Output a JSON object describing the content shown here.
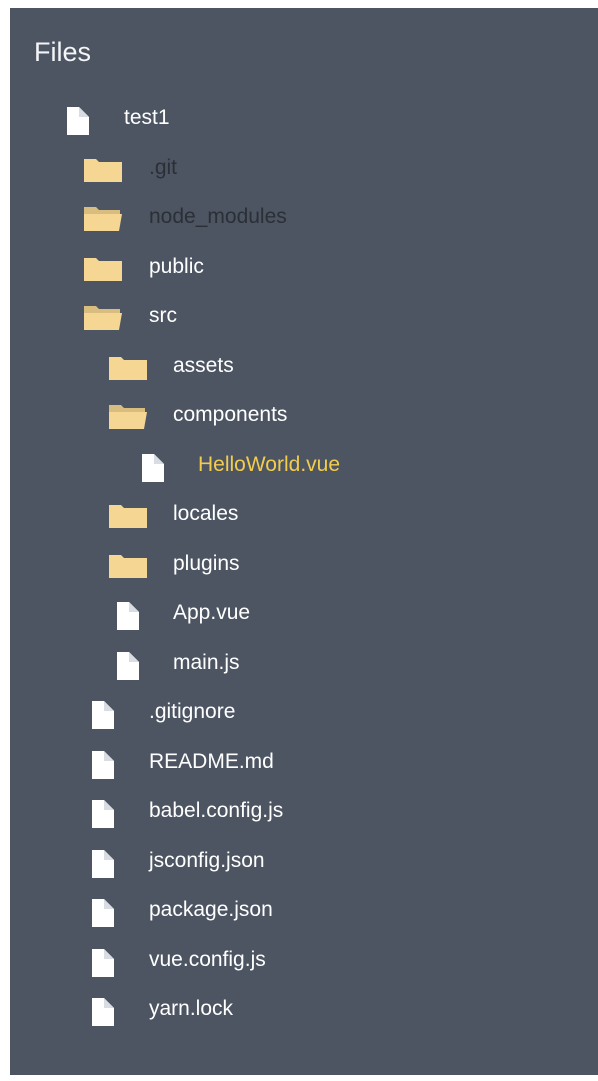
{
  "title": "Files",
  "colors": {
    "panel_bg": "#4d5563",
    "text": "#ffffff",
    "dimmed_text": "#2b2f36",
    "selected_text": "#f2cc4d",
    "folder": "#f6d693",
    "file": "#ffffff"
  },
  "tree": [
    {
      "name": "test1",
      "type": "file",
      "depth": 0
    },
    {
      "name": ".git",
      "type": "folder",
      "depth": 1,
      "dimmed": true
    },
    {
      "name": "node_modules",
      "type": "folder-open",
      "depth": 1,
      "dimmed": true
    },
    {
      "name": "public",
      "type": "folder",
      "depth": 1
    },
    {
      "name": "src",
      "type": "folder-open",
      "depth": 1
    },
    {
      "name": "assets",
      "type": "folder",
      "depth": 2
    },
    {
      "name": "components",
      "type": "folder-open",
      "depth": 2
    },
    {
      "name": "HelloWorld.vue",
      "type": "file",
      "depth": 3,
      "selected": true
    },
    {
      "name": "locales",
      "type": "folder",
      "depth": 2
    },
    {
      "name": "plugins",
      "type": "folder",
      "depth": 2
    },
    {
      "name": "App.vue",
      "type": "file",
      "depth": 2
    },
    {
      "name": "main.js",
      "type": "file",
      "depth": 2
    },
    {
      "name": ".gitignore",
      "type": "file",
      "depth": 1
    },
    {
      "name": "README.md",
      "type": "file",
      "depth": 1
    },
    {
      "name": "babel.config.js",
      "type": "file",
      "depth": 1
    },
    {
      "name": "jsconfig.json",
      "type": "file",
      "depth": 1
    },
    {
      "name": "package.json",
      "type": "file",
      "depth": 1
    },
    {
      "name": "vue.config.js",
      "type": "file",
      "depth": 1
    },
    {
      "name": "yarn.lock",
      "type": "file",
      "depth": 1
    }
  ]
}
